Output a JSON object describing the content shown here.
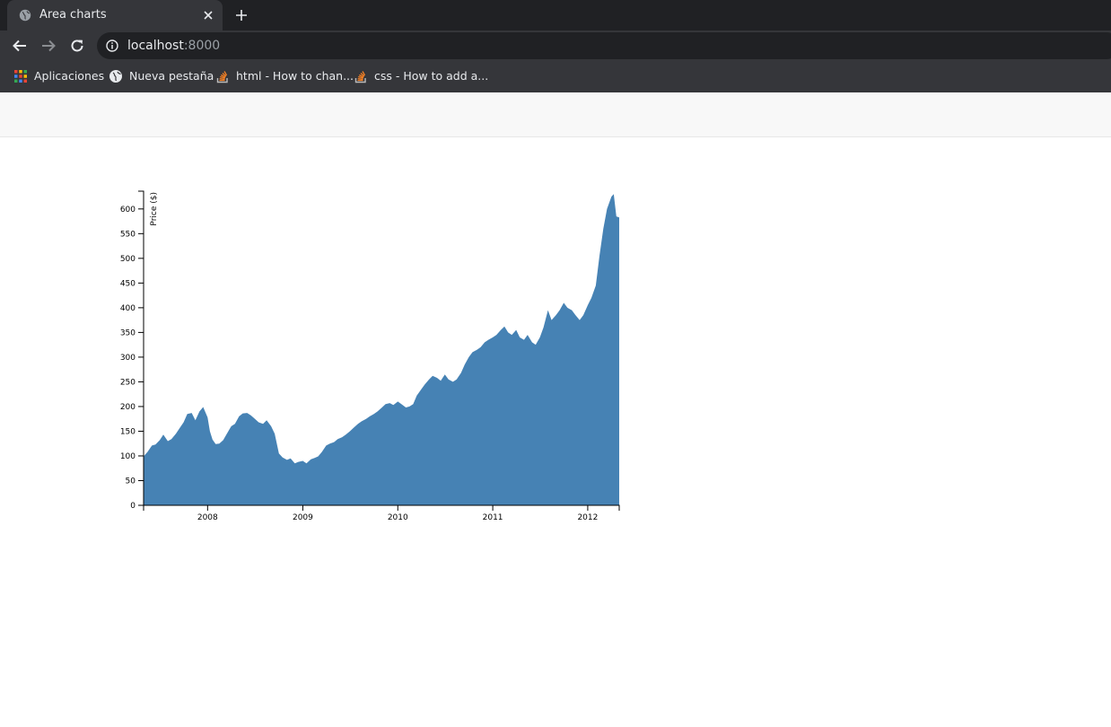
{
  "browser": {
    "tab_title": "Area charts",
    "url_host": "localhost",
    "url_port": ":8000",
    "bookmarks": [
      {
        "label": "Aplicaciones",
        "icon": "apps-grid-icon"
      },
      {
        "label": "Nueva pestaña",
        "icon": "globe-icon"
      },
      {
        "label": "html - How to chan...",
        "icon": "stackoverflow-icon"
      },
      {
        "label": "css - How to add a...",
        "icon": "stackoverflow-icon"
      }
    ]
  },
  "colors": {
    "area_fill": "#4682b4",
    "tabstrip": "#202124",
    "toolbar": "#35363a"
  },
  "chart_data": {
    "type": "area",
    "title": "",
    "xlabel": "",
    "ylabel": "Price ($)",
    "xlim": [
      "2007-04-30",
      "2012-05-01"
    ],
    "ylim": [
      0,
      636
    ],
    "x_ticks": [
      "2008",
      "2009",
      "2010",
      "2011",
      "2012"
    ],
    "y_ticks": [
      0,
      50,
      100,
      150,
      200,
      250,
      300,
      350,
      400,
      450,
      500,
      550,
      600
    ],
    "grid": false,
    "legend": "none",
    "series": [
      {
        "x": [
          "2007-04-30",
          "2007-05-15",
          "2007-06-01",
          "2007-06-15",
          "2007-07-01",
          "2007-07-15",
          "2007-08-01",
          "2007-08-15",
          "2007-09-01",
          "2007-09-15",
          "2007-10-01",
          "2007-10-15",
          "2007-11-01",
          "2007-11-15",
          "2007-12-01",
          "2007-12-15",
          "2008-01-01",
          "2008-01-10",
          "2008-01-20",
          "2008-02-01",
          "2008-02-15",
          "2008-03-01",
          "2008-03-15",
          "2008-04-01",
          "2008-04-15",
          "2008-05-01",
          "2008-05-15",
          "2008-06-01",
          "2008-06-15",
          "2008-07-01",
          "2008-07-15",
          "2008-08-01",
          "2008-08-15",
          "2008-09-01",
          "2008-09-15",
          "2008-10-01",
          "2008-10-15",
          "2008-11-01",
          "2008-11-15",
          "2008-12-01",
          "2008-12-15",
          "2009-01-01",
          "2009-01-15",
          "2009-02-01",
          "2009-02-15",
          "2009-03-01",
          "2009-03-15",
          "2009-04-01",
          "2009-04-15",
          "2009-05-01",
          "2009-05-15",
          "2009-06-01",
          "2009-06-15",
          "2009-07-01",
          "2009-07-15",
          "2009-08-01",
          "2009-08-15",
          "2009-09-01",
          "2009-09-15",
          "2009-10-01",
          "2009-10-15",
          "2009-11-01",
          "2009-11-15",
          "2009-12-01",
          "2009-12-15",
          "2010-01-01",
          "2010-01-15",
          "2010-02-01",
          "2010-02-15",
          "2010-03-01",
          "2010-03-15",
          "2010-04-01",
          "2010-04-15",
          "2010-05-01",
          "2010-05-15",
          "2010-06-01",
          "2010-06-15",
          "2010-07-01",
          "2010-07-15",
          "2010-08-01",
          "2010-08-15",
          "2010-09-01",
          "2010-09-15",
          "2010-10-01",
          "2010-10-15",
          "2010-11-01",
          "2010-11-15",
          "2010-12-01",
          "2010-12-15",
          "2011-01-01",
          "2011-01-15",
          "2011-02-01",
          "2011-02-15",
          "2011-03-01",
          "2011-03-15",
          "2011-04-01",
          "2011-04-15",
          "2011-05-01",
          "2011-05-15",
          "2011-06-01",
          "2011-06-15",
          "2011-07-01",
          "2011-07-15",
          "2011-08-01",
          "2011-08-15",
          "2011-09-01",
          "2011-09-15",
          "2011-10-01",
          "2011-10-15",
          "2011-11-01",
          "2011-11-15",
          "2011-12-01",
          "2011-12-15",
          "2012-01-01",
          "2012-01-15",
          "2012-02-01",
          "2012-02-15",
          "2012-03-01",
          "2012-03-15",
          "2012-04-01",
          "2012-04-10",
          "2012-04-20",
          "2012-05-01"
        ],
        "y": [
          99,
          108,
          121,
          123,
          132,
          143,
          130,
          134,
          145,
          156,
          168,
          185,
          187,
          172,
          190,
          199,
          178,
          150,
          133,
          124,
          125,
          132,
          145,
          160,
          165,
          180,
          186,
          187,
          182,
          175,
          168,
          165,
          172,
          160,
          145,
          105,
          97,
          92,
          95,
          85,
          88,
          90,
          85,
          93,
          96,
          99,
          108,
          121,
          125,
          128,
          134,
          138,
          143,
          150,
          157,
          165,
          170,
          175,
          180,
          185,
          190,
          198,
          205,
          207,
          203,
          210,
          205,
          198,
          200,
          205,
          222,
          235,
          245,
          255,
          262,
          258,
          252,
          265,
          255,
          250,
          255,
          268,
          285,
          300,
          310,
          315,
          320,
          330,
          335,
          340,
          345,
          355,
          362,
          350,
          345,
          355,
          340,
          335,
          345,
          330,
          325,
          340,
          360,
          395,
          375,
          385,
          395,
          410,
          400,
          395,
          385,
          375,
          385,
          405,
          420,
          445,
          505,
          560,
          600,
          625,
          630,
          585,
          583
        ]
      }
    ]
  }
}
